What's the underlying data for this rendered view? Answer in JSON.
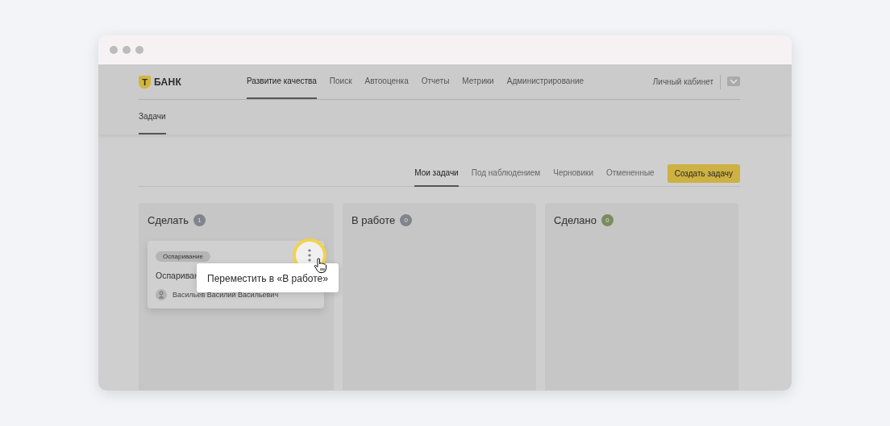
{
  "logo": {
    "text": "БАНК",
    "mark": "Т"
  },
  "nav": [
    {
      "label": "Развитие качества",
      "selected": true
    },
    {
      "label": "Поиск",
      "selected": false
    },
    {
      "label": "Автооценка",
      "selected": false
    },
    {
      "label": "Отчеты",
      "selected": false
    },
    {
      "label": "Метрики",
      "selected": false
    },
    {
      "label": "Администрирование",
      "selected": false
    }
  ],
  "account": {
    "label": "Личный кабинет"
  },
  "subnav": [
    {
      "label": "Задачи",
      "selected": true
    }
  ],
  "filters": [
    {
      "label": "Мои задачи",
      "selected": true
    },
    {
      "label": "Под наблюдением",
      "selected": false
    },
    {
      "label": "Черновики",
      "selected": false
    },
    {
      "label": "Отмененные",
      "selected": false
    }
  ],
  "create_button": "Создать задачу",
  "columns": [
    {
      "title": "Сделать",
      "count": "1",
      "color": "#7f848d",
      "cards": [
        {
          "tag": "Оспаривание",
          "title": "Оспариван",
          "assignee": "Васильев Василий Васильевич"
        }
      ]
    },
    {
      "title": "В работе",
      "count": "0",
      "color": "#7f848d"
    },
    {
      "title": "Сделано",
      "count": "0",
      "color": "#7a8c5e"
    }
  ],
  "menu": {
    "item": "Переместить в «В работе»"
  }
}
